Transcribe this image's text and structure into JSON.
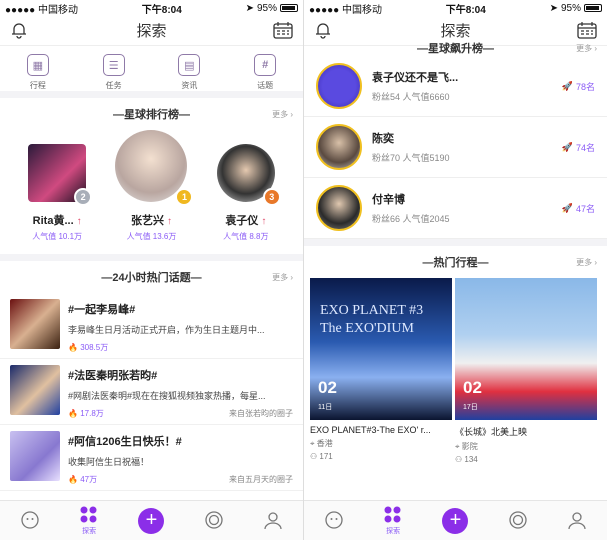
{
  "status": {
    "carrier": "●●●●● 中国移动",
    "time": "下午8:04",
    "battery": "95%"
  },
  "nav": {
    "title": "探索"
  },
  "quick": [
    {
      "icon": "grid-icon",
      "label": "行程"
    },
    {
      "icon": "list-icon",
      "label": "任务"
    },
    {
      "icon": "news-icon",
      "label": "资讯"
    },
    {
      "icon": "hash-icon",
      "label": "话题"
    }
  ],
  "leaderboard": {
    "title": "—星球排行榜—",
    "more": "更多 ›",
    "stars": [
      {
        "name": "Rita黄...",
        "pop": "人气值 10.1万",
        "rank": "2"
      },
      {
        "name": "张艺兴",
        "pop": "人气值 13.6万",
        "rank": "1"
      },
      {
        "name": "袁子仪",
        "pop": "人气值 8.8万",
        "rank": "3"
      }
    ]
  },
  "topics": {
    "title": "—24小时热门话题—",
    "more": "更多 ›",
    "items": [
      {
        "title": "#一起李易峰#",
        "desc": "李易峰生日月活动正式开启，作为生日主题月中...",
        "heat": "308.5万",
        "from": ""
      },
      {
        "title": "#法医秦明张若昀#",
        "desc": "#网剧法医秦明#现在在搜狐视频独家热播，每星...",
        "heat": "17.8万",
        "from": "来自张若昀的圈子"
      },
      {
        "title": "#阿信1206生日快乐！#",
        "desc": "收集阿信生日祝福！",
        "heat": "47万",
        "from": "来自五月天的圈子"
      }
    ]
  },
  "rising": {
    "title": "—星球飙升榜—",
    "more": "更多 ›",
    "items": [
      {
        "name": "袁子仪还不是飞...",
        "meta": "粉丝54  人气值6660",
        "rank": "78名"
      },
      {
        "name": "陈奕",
        "meta": "粉丝70  人气值5190",
        "rank": "74名"
      },
      {
        "name": "付辛博",
        "meta": "粉丝66  人气值2045",
        "rank": "47名"
      }
    ]
  },
  "hot_trips": {
    "title": "—热门行程—",
    "more": "更多 ›",
    "items": [
      {
        "day": "02",
        "month": "11日",
        "title": "EXO PLANET#3-The EXO' r...",
        "place": "香港",
        "count": "171",
        "banner": "EXO PLANET #3 The EXO'DIUM"
      },
      {
        "day": "02",
        "month": "17日",
        "title": "《长城》北美上映",
        "place": "影院",
        "count": "134",
        "banner": ""
      }
    ]
  },
  "tabs": {
    "explore": "探索"
  },
  "colors": {
    "accent": "#8b5cf6",
    "plus": "#8b2ee8"
  }
}
